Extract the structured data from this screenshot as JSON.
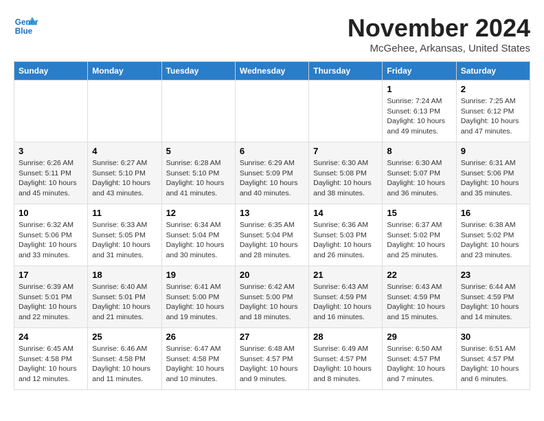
{
  "header": {
    "logo_line1": "General",
    "logo_line2": "Blue",
    "month": "November 2024",
    "location": "McGehee, Arkansas, United States"
  },
  "weekdays": [
    "Sunday",
    "Monday",
    "Tuesday",
    "Wednesday",
    "Thursday",
    "Friday",
    "Saturday"
  ],
  "weeks": [
    [
      {
        "day": "",
        "sunrise": "",
        "sunset": "",
        "daylight": ""
      },
      {
        "day": "",
        "sunrise": "",
        "sunset": "",
        "daylight": ""
      },
      {
        "day": "",
        "sunrise": "",
        "sunset": "",
        "daylight": ""
      },
      {
        "day": "",
        "sunrise": "",
        "sunset": "",
        "daylight": ""
      },
      {
        "day": "",
        "sunrise": "",
        "sunset": "",
        "daylight": ""
      },
      {
        "day": "1",
        "sunrise": "Sunrise: 7:24 AM",
        "sunset": "Sunset: 6:13 PM",
        "daylight": "Daylight: 10 hours and 49 minutes."
      },
      {
        "day": "2",
        "sunrise": "Sunrise: 7:25 AM",
        "sunset": "Sunset: 6:12 PM",
        "daylight": "Daylight: 10 hours and 47 minutes."
      }
    ],
    [
      {
        "day": "3",
        "sunrise": "Sunrise: 6:26 AM",
        "sunset": "Sunset: 5:11 PM",
        "daylight": "Daylight: 10 hours and 45 minutes."
      },
      {
        "day": "4",
        "sunrise": "Sunrise: 6:27 AM",
        "sunset": "Sunset: 5:10 PM",
        "daylight": "Daylight: 10 hours and 43 minutes."
      },
      {
        "day": "5",
        "sunrise": "Sunrise: 6:28 AM",
        "sunset": "Sunset: 5:10 PM",
        "daylight": "Daylight: 10 hours and 41 minutes."
      },
      {
        "day": "6",
        "sunrise": "Sunrise: 6:29 AM",
        "sunset": "Sunset: 5:09 PM",
        "daylight": "Daylight: 10 hours and 40 minutes."
      },
      {
        "day": "7",
        "sunrise": "Sunrise: 6:30 AM",
        "sunset": "Sunset: 5:08 PM",
        "daylight": "Daylight: 10 hours and 38 minutes."
      },
      {
        "day": "8",
        "sunrise": "Sunrise: 6:30 AM",
        "sunset": "Sunset: 5:07 PM",
        "daylight": "Daylight: 10 hours and 36 minutes."
      },
      {
        "day": "9",
        "sunrise": "Sunrise: 6:31 AM",
        "sunset": "Sunset: 5:06 PM",
        "daylight": "Daylight: 10 hours and 35 minutes."
      }
    ],
    [
      {
        "day": "10",
        "sunrise": "Sunrise: 6:32 AM",
        "sunset": "Sunset: 5:06 PM",
        "daylight": "Daylight: 10 hours and 33 minutes."
      },
      {
        "day": "11",
        "sunrise": "Sunrise: 6:33 AM",
        "sunset": "Sunset: 5:05 PM",
        "daylight": "Daylight: 10 hours and 31 minutes."
      },
      {
        "day": "12",
        "sunrise": "Sunrise: 6:34 AM",
        "sunset": "Sunset: 5:04 PM",
        "daylight": "Daylight: 10 hours and 30 minutes."
      },
      {
        "day": "13",
        "sunrise": "Sunrise: 6:35 AM",
        "sunset": "Sunset: 5:04 PM",
        "daylight": "Daylight: 10 hours and 28 minutes."
      },
      {
        "day": "14",
        "sunrise": "Sunrise: 6:36 AM",
        "sunset": "Sunset: 5:03 PM",
        "daylight": "Daylight: 10 hours and 26 minutes."
      },
      {
        "day": "15",
        "sunrise": "Sunrise: 6:37 AM",
        "sunset": "Sunset: 5:02 PM",
        "daylight": "Daylight: 10 hours and 25 minutes."
      },
      {
        "day": "16",
        "sunrise": "Sunrise: 6:38 AM",
        "sunset": "Sunset: 5:02 PM",
        "daylight": "Daylight: 10 hours and 23 minutes."
      }
    ],
    [
      {
        "day": "17",
        "sunrise": "Sunrise: 6:39 AM",
        "sunset": "Sunset: 5:01 PM",
        "daylight": "Daylight: 10 hours and 22 minutes."
      },
      {
        "day": "18",
        "sunrise": "Sunrise: 6:40 AM",
        "sunset": "Sunset: 5:01 PM",
        "daylight": "Daylight: 10 hours and 21 minutes."
      },
      {
        "day": "19",
        "sunrise": "Sunrise: 6:41 AM",
        "sunset": "Sunset: 5:00 PM",
        "daylight": "Daylight: 10 hours and 19 minutes."
      },
      {
        "day": "20",
        "sunrise": "Sunrise: 6:42 AM",
        "sunset": "Sunset: 5:00 PM",
        "daylight": "Daylight: 10 hours and 18 minutes."
      },
      {
        "day": "21",
        "sunrise": "Sunrise: 6:43 AM",
        "sunset": "Sunset: 4:59 PM",
        "daylight": "Daylight: 10 hours and 16 minutes."
      },
      {
        "day": "22",
        "sunrise": "Sunrise: 6:43 AM",
        "sunset": "Sunset: 4:59 PM",
        "daylight": "Daylight: 10 hours and 15 minutes."
      },
      {
        "day": "23",
        "sunrise": "Sunrise: 6:44 AM",
        "sunset": "Sunset: 4:59 PM",
        "daylight": "Daylight: 10 hours and 14 minutes."
      }
    ],
    [
      {
        "day": "24",
        "sunrise": "Sunrise: 6:45 AM",
        "sunset": "Sunset: 4:58 PM",
        "daylight": "Daylight: 10 hours and 12 minutes."
      },
      {
        "day": "25",
        "sunrise": "Sunrise: 6:46 AM",
        "sunset": "Sunset: 4:58 PM",
        "daylight": "Daylight: 10 hours and 11 minutes."
      },
      {
        "day": "26",
        "sunrise": "Sunrise: 6:47 AM",
        "sunset": "Sunset: 4:58 PM",
        "daylight": "Daylight: 10 hours and 10 minutes."
      },
      {
        "day": "27",
        "sunrise": "Sunrise: 6:48 AM",
        "sunset": "Sunset: 4:57 PM",
        "daylight": "Daylight: 10 hours and 9 minutes."
      },
      {
        "day": "28",
        "sunrise": "Sunrise: 6:49 AM",
        "sunset": "Sunset: 4:57 PM",
        "daylight": "Daylight: 10 hours and 8 minutes."
      },
      {
        "day": "29",
        "sunrise": "Sunrise: 6:50 AM",
        "sunset": "Sunset: 4:57 PM",
        "daylight": "Daylight: 10 hours and 7 minutes."
      },
      {
        "day": "30",
        "sunrise": "Sunrise: 6:51 AM",
        "sunset": "Sunset: 4:57 PM",
        "daylight": "Daylight: 10 hours and 6 minutes."
      }
    ]
  ]
}
